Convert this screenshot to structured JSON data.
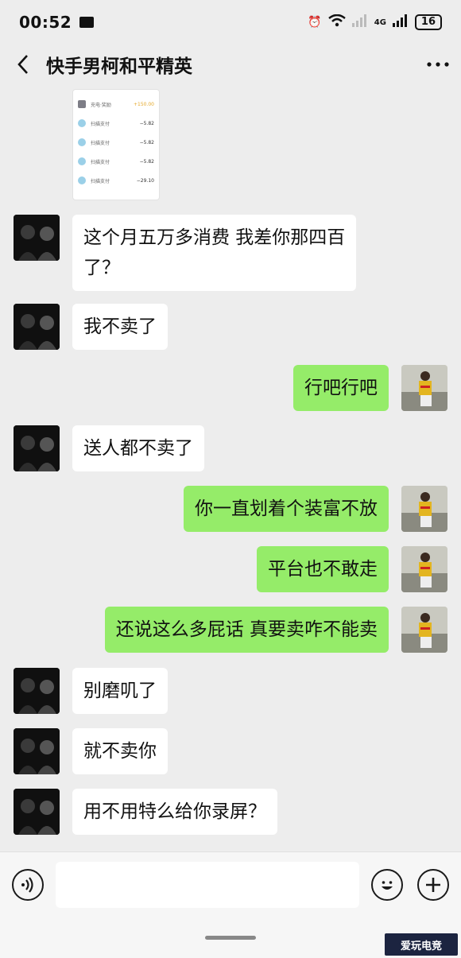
{
  "status_bar": {
    "time": "00:52",
    "network": "4G",
    "battery": "16"
  },
  "header": {
    "title": "快手男柯和平精英"
  },
  "thumbnail": {
    "rows": [
      {
        "label": "充电·奖励",
        "amount": "+150.00",
        "highlight": true
      },
      {
        "label": "扫描支付",
        "amount": "−5.82",
        "highlight": false
      },
      {
        "label": "扫描支付",
        "amount": "−5.82",
        "highlight": false
      },
      {
        "label": "扫描支付",
        "amount": "−5.82",
        "highlight": false
      },
      {
        "label": "扫描支付",
        "amount": "−29.10",
        "highlight": false
      }
    ]
  },
  "messages": [
    {
      "from": "them",
      "text": "这个月五万多消费 我差你那四百\n了？"
    },
    {
      "from": "them",
      "text": "我不卖了"
    },
    {
      "from": "me",
      "text": "行吧行吧"
    },
    {
      "from": "them",
      "text": "送人都不卖了"
    },
    {
      "from": "me",
      "text": "你一直划着个装富不放"
    },
    {
      "from": "me",
      "text": "平台也不敢走"
    },
    {
      "from": "me",
      "text": "还说这么多屁话 真要卖咋不能卖"
    },
    {
      "from": "them",
      "text": "别磨叽了"
    },
    {
      "from": "them",
      "text": "就不卖你"
    },
    {
      "from": "them",
      "text": "用不用特么给你录屏？"
    }
  ],
  "input": {
    "value": "",
    "placeholder": ""
  },
  "watermark": "爱玩电竞",
  "colors": {
    "sent_bubble": "#95ec69",
    "received_bubble": "#ffffff",
    "background": "#ededed"
  }
}
